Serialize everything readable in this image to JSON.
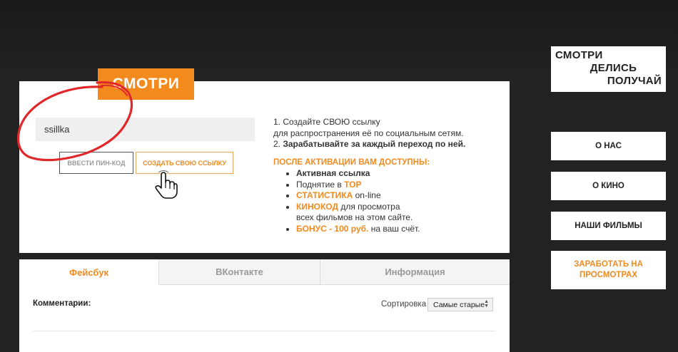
{
  "card": {
    "badge": "СМОТРИ",
    "link_value": "ssillka",
    "pin_button": "ВВЕСТИ ПИН-КОД",
    "create_button": "СОЗДАТЬ СВОЮ ССЫЛКУ"
  },
  "info": {
    "step1_a": "1. Создайте СВОЮ ссылку",
    "step1_b": "для распространения её по социальным сетям.",
    "step2_num": "2. ",
    "step2_text": "Зарабатывайте за каждый переход по ней.",
    "after_header": "ПОСЛЕ АКТИВАЦИИ ВАМ ДОСТУПНЫ:",
    "item1": "Активная ссылка",
    "item2_a": "Поднятие в ",
    "item2_b": "TOP",
    "item3_a": "СТАТИСТИКА",
    "item3_b": " on-line",
    "item4_a": "КИНОКОД",
    "item4_b": " для просмотра",
    "item4_c": "всех фильмов на этом сайте.",
    "item5_a": "БОНУС - 100 руб.",
    "item5_b": " на ваш счёт."
  },
  "tabs": [
    "Фейсбук",
    "ВКонтакте",
    "Информация"
  ],
  "comments": {
    "label": "Комментарии:",
    "sort_label": "Сортировка",
    "sort_value": "Самые старые"
  },
  "sidebar": {
    "logo_lines": [
      "СМОТРИ",
      "ДЕЛИСЬ",
      "ПОЛУЧАЙ"
    ],
    "nav": [
      "О НАС",
      "О КИНО",
      "НАШИ ФИЛЬМЫ",
      "ЗАРАБОТАТЬ НА ПРОСМОТРАХ"
    ]
  },
  "colors": {
    "accent": "#f28a1e",
    "background": "#222222",
    "circle": "#e0282a"
  },
  "icons": [
    "hand-pointer-icon",
    "sort-arrows-icon"
  ]
}
